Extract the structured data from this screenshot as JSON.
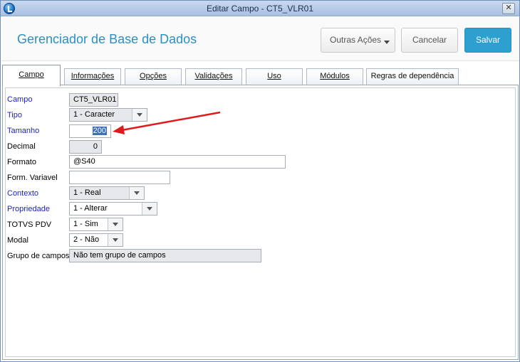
{
  "window": {
    "title": "Editar Campo - CT5_VLR01"
  },
  "header": {
    "app_title": "Gerenciador de Base de Dados",
    "outras_acoes": "Outras Ações",
    "cancelar": "Cancelar",
    "salvar": "Salvar"
  },
  "tabs": [
    {
      "label": "Campo",
      "active": true
    },
    {
      "label": "Informações"
    },
    {
      "label": "Opções"
    },
    {
      "label": "Validações"
    },
    {
      "label": "Uso"
    },
    {
      "label": "Módulos"
    },
    {
      "label": "Regras de dependência"
    }
  ],
  "form": {
    "campo": {
      "label": "Campo",
      "value": "CT5_VLR01"
    },
    "tipo": {
      "label": "Tipo",
      "value": "1 - Caracter"
    },
    "tamanho": {
      "label": "Tamanho",
      "value": "200"
    },
    "decimal": {
      "label": "Decimal",
      "value": "0"
    },
    "formato": {
      "label": "Formato",
      "value": "@S40"
    },
    "form_variavel": {
      "label": "Form. Variavel",
      "value": ""
    },
    "contexto": {
      "label": "Contexto",
      "value": "1 - Real"
    },
    "propriedade": {
      "label": "Propriedade",
      "value": "1 - Alterar"
    },
    "totvs_pdv": {
      "label": "TOTVS PDV",
      "value": "1 - Sim"
    },
    "modal": {
      "label": "Modal",
      "value": "2 - Não"
    },
    "grupo_campos": {
      "label": "Grupo de campos",
      "value": "Não tem grupo de campos"
    }
  },
  "colors": {
    "accent": "#2a90c2",
    "primary_button": "#2ea0cf",
    "required_label": "#1d22c8",
    "annotation_arrow": "#e01a1a"
  }
}
